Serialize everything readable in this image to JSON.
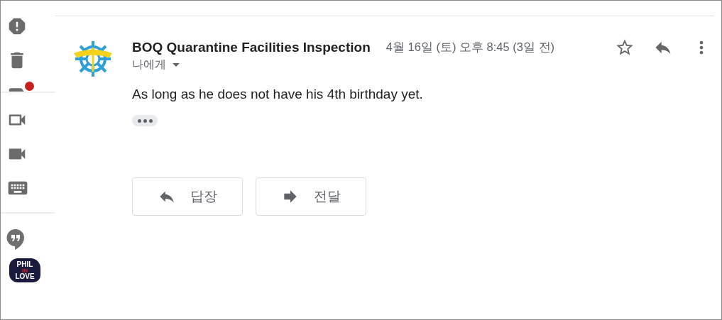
{
  "sidebar": {
    "label_unread": true,
    "app_tile": {
      "lines": [
        "PHIL",
        "IN",
        "LOVE"
      ]
    }
  },
  "message": {
    "sender": "BOQ Quarantine Facilities Inspection",
    "date": "4월 16일 (토) 오후 8:45 (3일 전)",
    "starred": false,
    "recipient": "나에게",
    "body": "As long as he does not have his 4th birthday yet."
  },
  "actions": [
    {
      "kind": "reply",
      "label": "답장"
    },
    {
      "kind": "forward",
      "label": "전달"
    }
  ]
}
